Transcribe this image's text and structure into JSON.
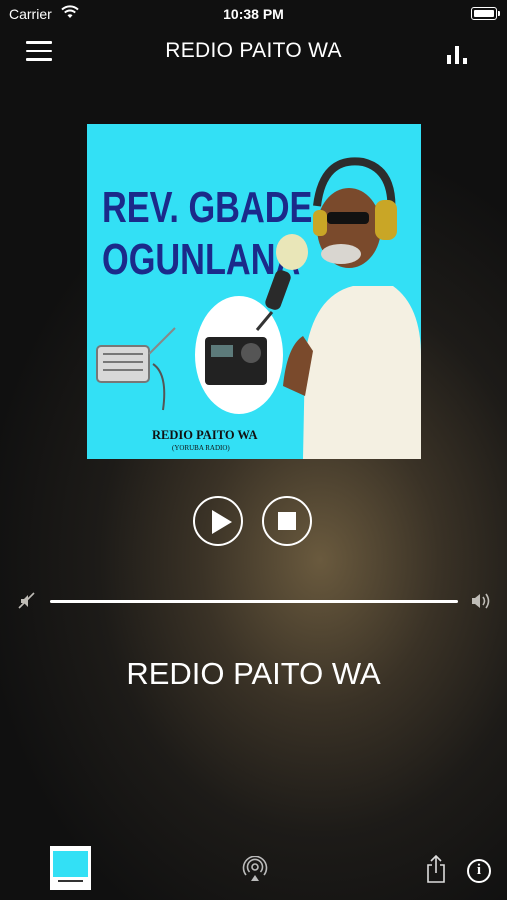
{
  "status_bar": {
    "carrier": "Carrier",
    "time": "10:38 PM"
  },
  "nav": {
    "title": "REDIO PAITO WA",
    "menu_icon": "hamburger-menu-icon",
    "equalizer_icon": "equalizer-icon"
  },
  "artwork": {
    "title_line1": "REV. GBADE",
    "title_line2": "OGUNLANA",
    "footer_main": "REDIO PAITO WA",
    "footer_sub": "(YORUBA RADIO)",
    "background_color": "#33e0f5",
    "title_color": "#1b2a8a"
  },
  "controls": {
    "play_icon": "play-icon",
    "stop_icon": "stop-icon"
  },
  "volume": {
    "level": 1.0,
    "low_icon": "volume-mute-icon",
    "high_icon": "volume-up-icon"
  },
  "now_playing": {
    "station": "REDIO PAITO WA"
  },
  "bottom_bar": {
    "airplay_icon": "airplay-icon",
    "share_icon": "share-icon",
    "info_icon": "info-icon",
    "info_glyph": "i"
  }
}
